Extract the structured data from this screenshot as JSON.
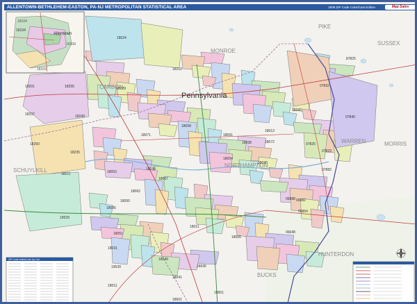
{
  "header": {
    "title": "ALLENTOWN-BETHLEHEM-EASTON, PA-NJ METROPOLITAN STATISTICAL AREA",
    "edition": "2008 ZIP Code Color/Cast Edition",
    "brand": "Map Sales"
  },
  "state_label": "Pennsylvania",
  "counties": [
    "PIKE",
    "MONROE",
    "SUSSEX",
    "CARBON",
    "WARREN",
    "MORRIS",
    "SCHUYLKILL",
    "NORTHAMPTON",
    "HUNTERDON",
    "BUCKS"
  ],
  "inset": {
    "city": "Allentown",
    "zips": [
      "18104",
      "18103",
      "18109"
    ]
  },
  "zip_labels": [
    "18104",
    "18024",
    "18210",
    "87825",
    "18201",
    "18255",
    "18229",
    "07832",
    "18237",
    "18240",
    "18343",
    "07840",
    "18250",
    "18071",
    "18058",
    "18091",
    "18013",
    "07825",
    "18235",
    "18038",
    "18072",
    "07823",
    "18211",
    "18088",
    "18054",
    "18040",
    "07882",
    "18053",
    "18062",
    "18067",
    "18050",
    "18056",
    "06888",
    "06882",
    "19529",
    "18051",
    "18011",
    "18055",
    "06854",
    "06648",
    "18031",
    "18049",
    "18036",
    "19539",
    "18041",
    "18951",
    "18011",
    "18601"
  ],
  "legend": {
    "title": "ZIP Code Index/Look Up List"
  },
  "colors": {
    "frame": "#3f5f9c",
    "title_bg": "#2a5aa0",
    "water": "#c9e1f0",
    "state_line": "#4a4a9a",
    "road": "#c23a3a",
    "highway": "#3a8a3a",
    "label": "#8a8a8a"
  }
}
